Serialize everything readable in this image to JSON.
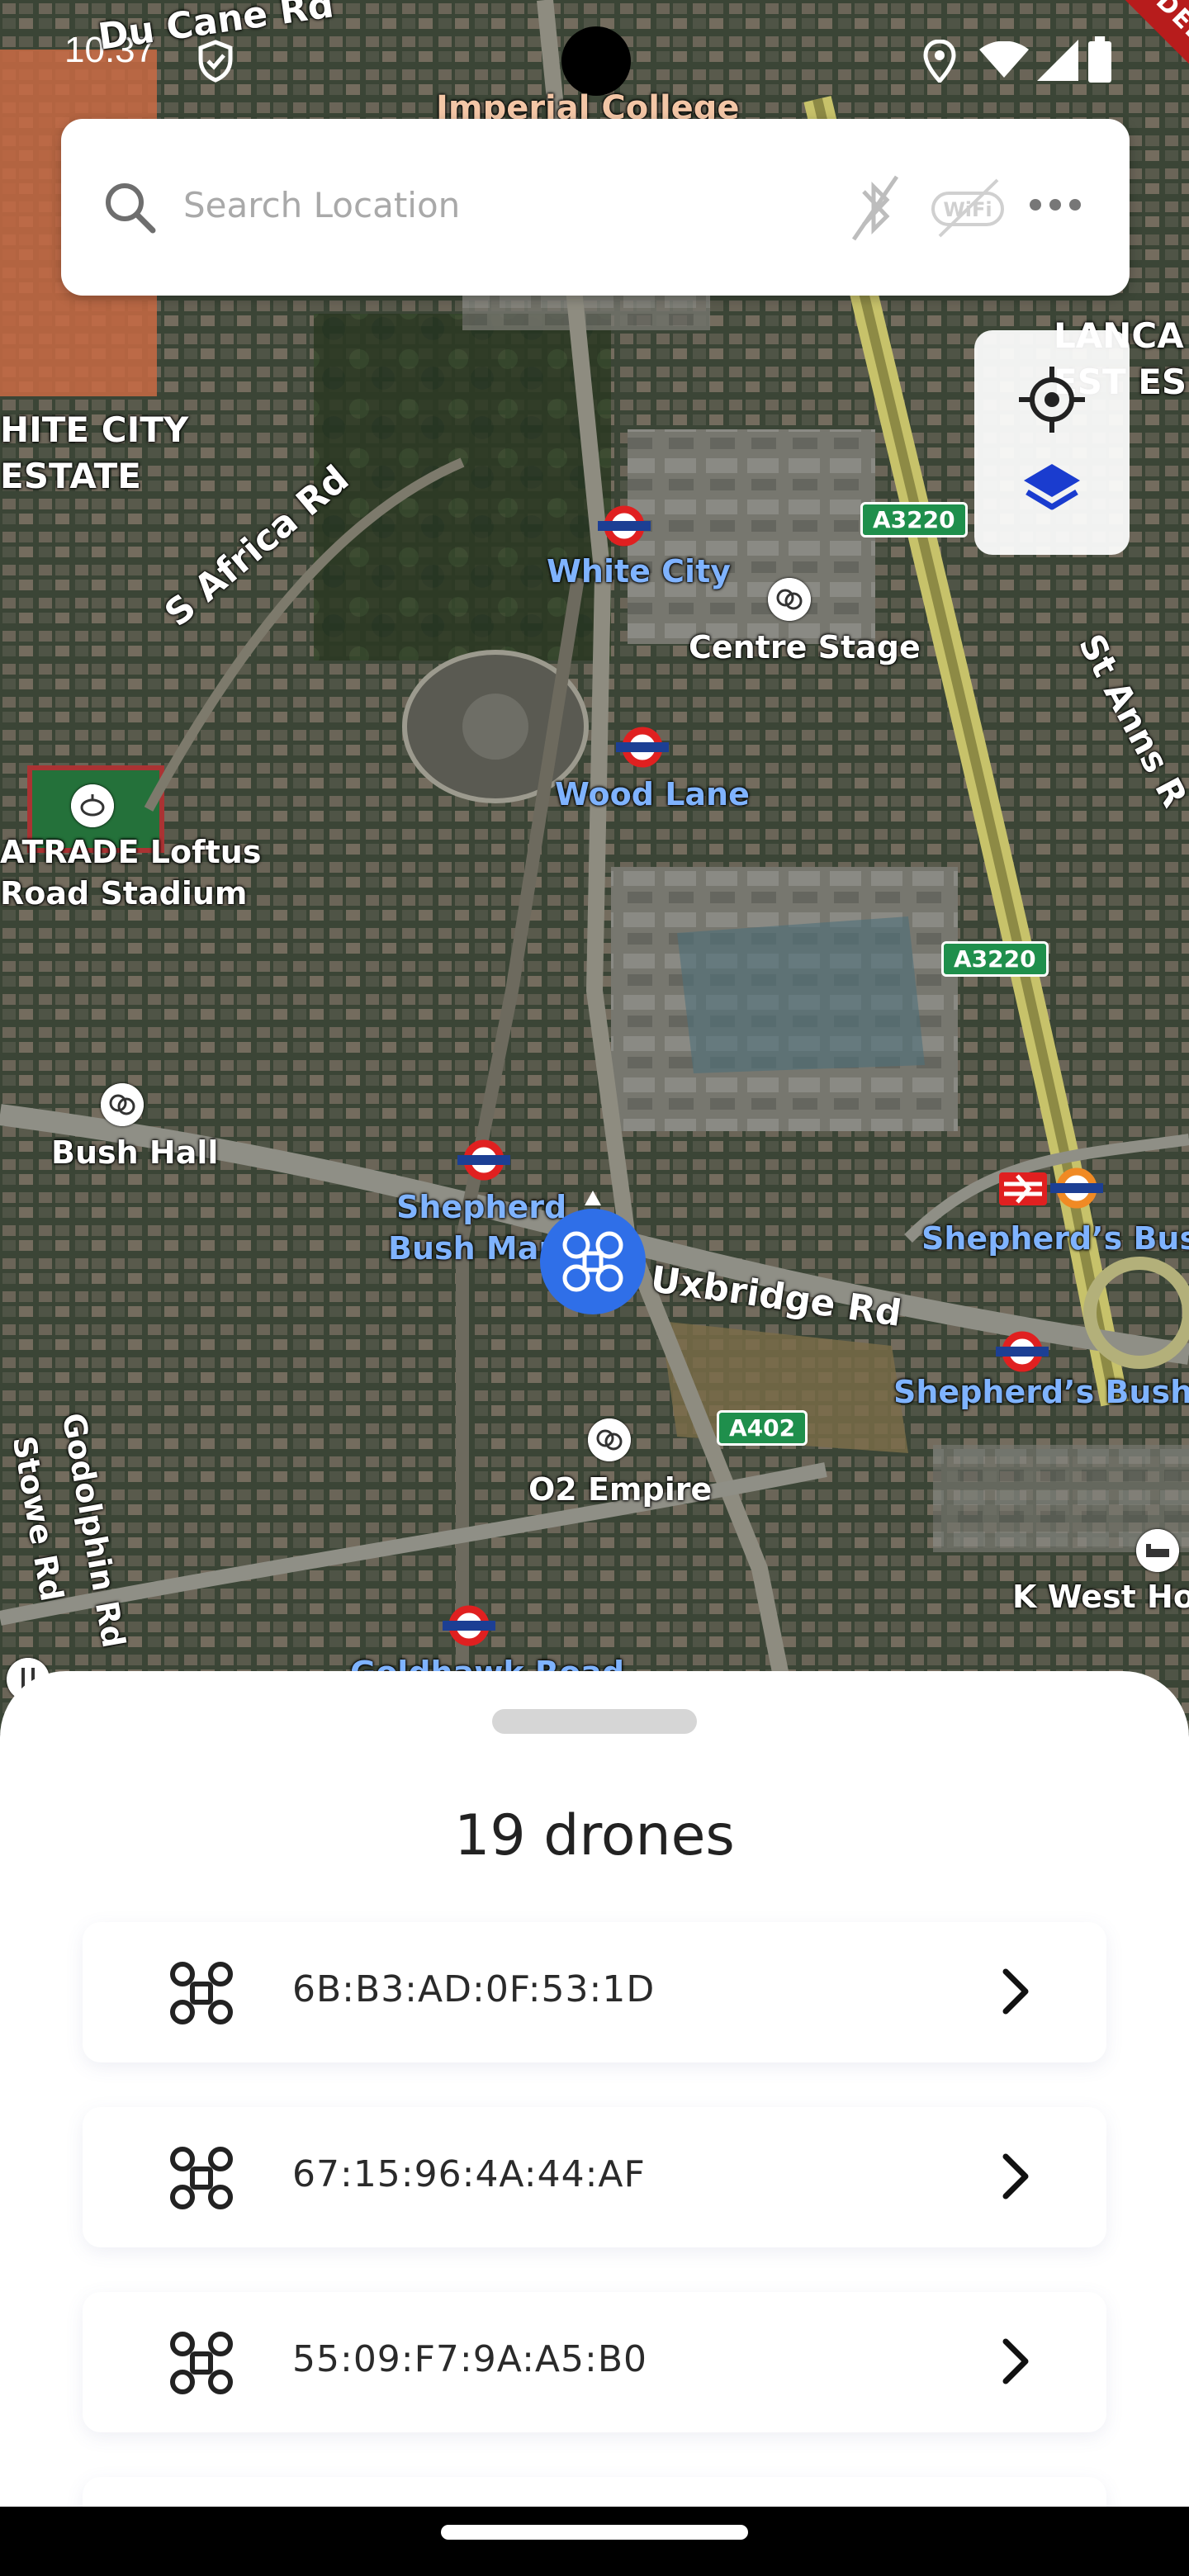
{
  "status_bar": {
    "time": "10:37"
  },
  "debug_banner": "DEBUG",
  "search": {
    "placeholder": "Search Location"
  },
  "map": {
    "labels": {
      "du_cane": "Du Cane Rd",
      "imperial": "Imperial College",
      "white_city_estate_1": "HITE CITY",
      "white_city_estate_2": "ESTATE",
      "lanca_1": "LANCA",
      "lanca_2": "EST ES",
      "s_africa": "S Africa Rd",
      "white_city": "White City",
      "centre_stage": "Centre Stage",
      "wood_lane": "Wood Lane",
      "st_anns": "St Anns R",
      "loftus_1": "ATRADE Loftus",
      "loftus_2": "Road Stadium",
      "bush_hall": "Bush Hall",
      "shepherds_market_1": "Shepherd",
      "shepherds_market_2": "Bush Mark",
      "uxbridge": "Uxbridge Rd",
      "shepherds_bush_rail": "Shepherd’s Bush",
      "shepherds_bush_tube": "Shepherd’s Bush",
      "o2_empire": "O2 Empire",
      "godolphin": "Godolphin Rd",
      "stowe": "Stowe Rd",
      "k_west": "K West Hote",
      "goldhawk": "Goldhawk Road"
    },
    "road_badges": {
      "a3220_top": "A3220",
      "a3220_mid": "A3220",
      "a402": "A402"
    }
  },
  "sheet": {
    "title": "19 drones",
    "drones": [
      {
        "mac": "6B:B3:AD:0F:53:1D"
      },
      {
        "mac": "67:15:96:4A:44:AF"
      },
      {
        "mac": "55:09:F7:9A:A5:B0"
      }
    ]
  },
  "colors": {
    "accent": "#2f6fe8",
    "map_label_blue": "#7fb3ff",
    "road_badge": "#1f8f4c"
  }
}
